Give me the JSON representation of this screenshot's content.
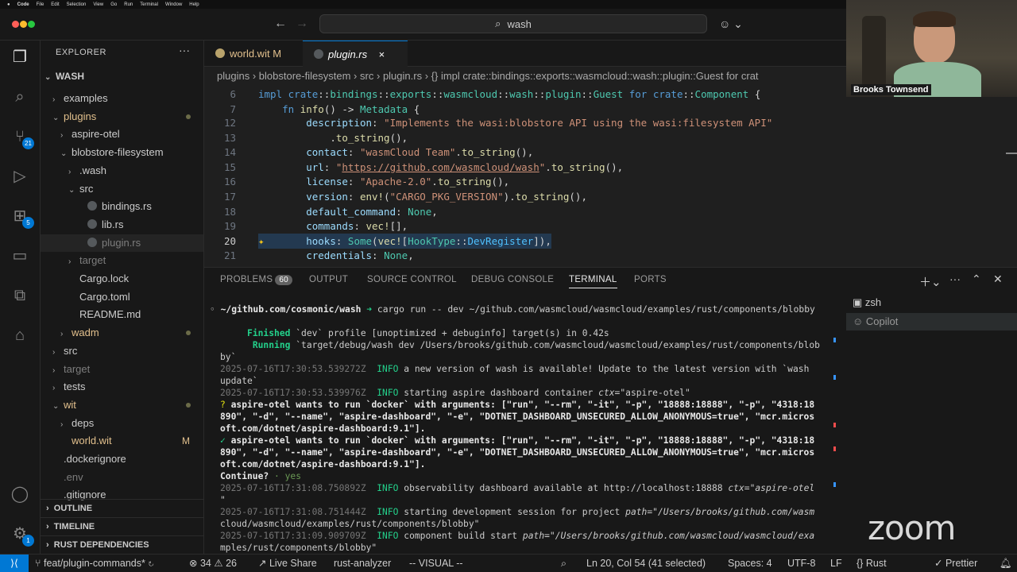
{
  "menubar": {
    "app": "Code",
    "items": [
      "File",
      "Edit",
      "Selection",
      "View",
      "Go",
      "Run",
      "Terminal",
      "Window",
      "Help"
    ]
  },
  "search": {
    "text": "wash"
  },
  "sidebar": {
    "title": "EXPLORER",
    "root": "WASH",
    "items": [
      {
        "label": "examples",
        "indent": 1,
        "chev": "›",
        "state": "normal"
      },
      {
        "label": "plugins",
        "indent": 1,
        "chev": "⌄",
        "state": "mod",
        "dot": true
      },
      {
        "label": "aspire-otel",
        "indent": 2,
        "chev": "›",
        "state": "normal"
      },
      {
        "label": "blobstore-filesystem",
        "indent": 2,
        "chev": "⌄",
        "state": "normal"
      },
      {
        "label": ".wash",
        "indent": 3,
        "chev": "›",
        "state": "normal"
      },
      {
        "label": "src",
        "indent": 3,
        "chev": "⌄",
        "state": "normal"
      },
      {
        "label": "bindings.rs",
        "indent": 4,
        "chev": "",
        "state": "normal",
        "rs": true
      },
      {
        "label": "lib.rs",
        "indent": 4,
        "chev": "",
        "state": "normal",
        "rs": true
      },
      {
        "label": "plugin.rs",
        "indent": 4,
        "chev": "",
        "state": "dim",
        "rs": true
      },
      {
        "label": "target",
        "indent": 3,
        "chev": "›",
        "state": "dim"
      },
      {
        "label": "Cargo.lock",
        "indent": 3,
        "chev": "",
        "state": "normal"
      },
      {
        "label": "Cargo.toml",
        "indent": 3,
        "chev": "",
        "state": "normal"
      },
      {
        "label": "README.md",
        "indent": 3,
        "chev": "",
        "state": "normal"
      },
      {
        "label": "wadm",
        "indent": 2,
        "chev": "›",
        "state": "mod",
        "dot": true
      },
      {
        "label": "src",
        "indent": 1,
        "chev": "›",
        "state": "normal"
      },
      {
        "label": "target",
        "indent": 1,
        "chev": "›",
        "state": "dim"
      },
      {
        "label": "tests",
        "indent": 1,
        "chev": "›",
        "state": "normal"
      },
      {
        "label": "wit",
        "indent": 1,
        "chev": "⌄",
        "state": "mod",
        "dot": true
      },
      {
        "label": "deps",
        "indent": 2,
        "chev": "›",
        "state": "normal"
      },
      {
        "label": "world.wit",
        "indent": 2,
        "chev": "",
        "state": "mod",
        "mark": "M"
      },
      {
        "label": ".dockerignore",
        "indent": 1,
        "chev": "",
        "state": "normal"
      },
      {
        "label": ".env",
        "indent": 1,
        "chev": "",
        "state": "dim"
      },
      {
        "label": ".gitignore",
        "indent": 1,
        "chev": "",
        "state": "normal"
      }
    ],
    "sections": [
      "OUTLINE",
      "TIMELINE",
      "RUST DEPENDENCIES"
    ]
  },
  "activity": {
    "scm_badge": "21",
    "ext_badge": "5",
    "acct_badge": "1"
  },
  "tabs": [
    {
      "label": "world.wit",
      "mark": "M",
      "active": false
    },
    {
      "label": "plugin.rs",
      "mark": "×",
      "active": true
    }
  ],
  "breadcrumb": [
    "plugins",
    "›",
    "blobstore-filesystem",
    "›",
    "src",
    "›",
    "plugin.rs",
    "›",
    "{} impl crate::bindings::exports::wasmcloud::wash::plugin::Guest for crat"
  ],
  "editor": {
    "lines": [
      {
        "n": "6",
        "text": "impl crate::bindings::exports::wasmcloud::wash::plugin::Guest for crate::Component {"
      },
      {
        "n": "7",
        "text": "    fn info() -> Metadata {"
      },
      {
        "n": "12",
        "text": "        description: \"Implements the wasi:blobstore API using the wasi:filesystem API\""
      },
      {
        "n": "13",
        "text": "            .to_string(),"
      },
      {
        "n": "14",
        "text": "        contact: \"wasmCloud Team\".to_string(),"
      },
      {
        "n": "15",
        "text": "        url: \"https://github.com/wasmcloud/wash\".to_string(),"
      },
      {
        "n": "16",
        "text": "        license: \"Apache-2.0\".to_string(),"
      },
      {
        "n": "17",
        "text": "        version: env!(\"CARGO_PKG_VERSION\").to_string(),"
      },
      {
        "n": "18",
        "text": "        default_command: None,"
      },
      {
        "n": "19",
        "text": "        commands: vec![],"
      },
      {
        "n": "20",
        "text": "        hooks: Some(vec![HookType::DevRegister]),"
      },
      {
        "n": "21",
        "text": "        credentials: None,"
      }
    ]
  },
  "panel": {
    "tabs": [
      "PROBLEMS",
      "OUTPUT",
      "SOURCE CONTROL",
      "DEBUG CONSOLE",
      "TERMINAL",
      "PORTS"
    ],
    "problems_count": "60",
    "terminals": [
      "zsh",
      "Copilot"
    ]
  },
  "terminal": {
    "prompt_path": "~/github.com/cosmonic/wash",
    "prompt_cmd": "cargo run -- dev ~/github.com/wasmcloud/wasmcloud/examples/rust/components/blobby",
    "finished_label": "Finished",
    "finished_text": "`dev` profile [unoptimized + debuginfo] target(s) in 0.42s",
    "running_label": "Running",
    "running_text": "`target/debug/wash dev /Users/brooks/github.com/wasmcloud/wasmcloud/examples/rust/components/blob",
    "running_wrap": "by`",
    "log1_ts": "2025-07-16T17:30:53.539272Z",
    "log1_level": "INFO",
    "log1_msg": "a new version of wash is available! Update to the latest version with `wash",
    "log1_wrap": "update`",
    "log2_ts": "2025-07-16T17:30:53.539976Z",
    "log2_level": "INFO",
    "log2_msg": "starting aspire dashboard container",
    "log2_ctx_key": "ctx",
    "log2_ctx_val": "=\"aspire-otel\"",
    "q_mark": "?",
    "q_text": "aspire-otel wants to run `docker` with arguments: [\"run\", \"--rm\", \"-it\", \"-p\", \"18888:18888\", \"-p\", \"4318:18",
    "q_wrap1": "890\", \"-d\", \"--name\", \"aspire-dashboard\", \"-e\", \"DOTNET_DASHBOARD_UNSECURED_ALLOW_ANONYMOUS=true\", \"mcr.micros",
    "q_wrap2": "oft.com/dotnet/aspire-dashboard:9.1\"].",
    "a_mark": "✓",
    "a_text": "aspire-otel wants to run `docker` with arguments: [\"run\", \"--rm\", \"-it\", \"-p\", \"18888:18888\", \"-p\", \"4318:18",
    "a_wrap1": "890\", \"-d\", \"--name\", \"aspire-dashboard\", \"-e\", \"DOTNET_DASHBOARD_UNSECURED_ALLOW_ANONYMOUS=true\", \"mcr.micros",
    "a_wrap2": "oft.com/dotnet/aspire-dashboard:9.1\"].",
    "continue_label": "Continue?",
    "continue_answer": "· yes",
    "log3_ts": "2025-07-16T17:31:08.750892Z",
    "log3_level": "INFO",
    "log3_msg": "observability dashboard available at http://localhost:18888",
    "log3_ctx": "ctx=\"aspire-otel",
    "log3_wrap": "\"",
    "log4_ts": "2025-07-16T17:31:08.751444Z",
    "log4_level": "INFO",
    "log4_msg": "starting development session for project",
    "log4_path": "path=\"/Users/brooks/github.com/wasm",
    "log4_wrap": "cloud/wasmcloud/examples/rust/components/blobby\"",
    "log5_ts": "2025-07-16T17:31:09.909709Z",
    "log5_level": "INFO",
    "log5_msg": "component build start",
    "log5_path": "path=\"/Users/brooks/github.com/wasmcloud/wasmcloud/exa",
    "log5_wrap": "mples/rust/components/blobby\""
  },
  "statusbar": {
    "branch": "feat/plugin-commands*",
    "errors": "34",
    "warnings": "26",
    "live_share": "Live Share",
    "analyzer": "rust-analyzer",
    "mode": "-- VISUAL --",
    "position": "Ln 20, Col 54 (41 selected)",
    "spaces": "Spaces: 4",
    "encoding": "UTF-8",
    "eol": "LF",
    "language": "Rust",
    "prettier": "Prettier"
  },
  "webcam": {
    "name": "Brooks Townsend"
  },
  "overlay": {
    "logo": "zoom"
  }
}
